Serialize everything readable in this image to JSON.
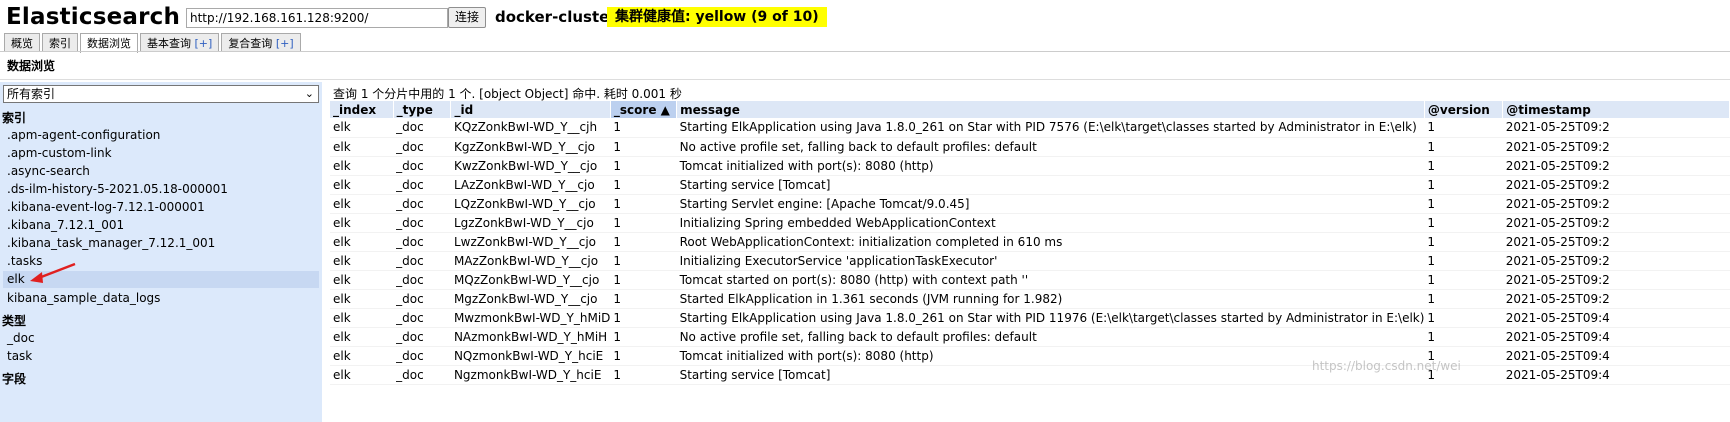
{
  "app": {
    "title": "Elasticsearch"
  },
  "connection": {
    "url": "http://192.168.161.128:9200/",
    "connect_label": "连接",
    "cluster_name": "docker-cluster",
    "health": "集群健康值: yellow (9 of 10)",
    "health_color": "#ffff00"
  },
  "tabs": [
    {
      "label": "概览",
      "plus": ""
    },
    {
      "label": "索引",
      "plus": ""
    },
    {
      "label": "数据浏览",
      "plus": ""
    },
    {
      "label": "基本查询 ",
      "plus": "[+]"
    },
    {
      "label": "复合查询 ",
      "plus": "[+]"
    }
  ],
  "active_tab": "数据浏览",
  "page": {
    "title": "数据浏览"
  },
  "sidebar": {
    "index_select": "所有索引",
    "indices_title": "索引",
    "indices": [
      ".apm-agent-configuration",
      ".apm-custom-link",
      ".async-search",
      ".ds-ilm-history-5-2021.05.18-000001",
      ".kibana-event-log-7.12.1-000001",
      ".kibana_7.12.1_001",
      ".kibana_task_manager_7.12.1_001",
      ".tasks",
      "elk",
      "kibana_sample_data_logs"
    ],
    "selected_index": "elk",
    "types_title": "类型",
    "types": [
      "_doc",
      "task"
    ],
    "fields_title": "字段"
  },
  "results": {
    "summary": "查询 1 个分片中用的 1 个. [object Object] 命中. 耗时 0.001 秒",
    "columns": [
      "_index",
      "_type",
      "_id",
      "_score ▲",
      "message",
      "@version",
      "@timestamp"
    ],
    "rows": [
      [
        "elk",
        "_doc",
        "KQzZonkBwI-WD_Y__cjh",
        "1",
        "Starting ElkApplication using Java 1.8.0_261 on Star with PID 7576 (E:\\elk\\target\\classes started by Administrator in E:\\elk)",
        "1",
        "2021-05-25T09:2"
      ],
      [
        "elk",
        "_doc",
        "KgzZonkBwI-WD_Y__cjo",
        "1",
        "No active profile set, falling back to default profiles: default",
        "1",
        "2021-05-25T09:2"
      ],
      [
        "elk",
        "_doc",
        "KwzZonkBwI-WD_Y__cjo",
        "1",
        "Tomcat initialized with port(s): 8080 (http)",
        "1",
        "2021-05-25T09:2"
      ],
      [
        "elk",
        "_doc",
        "LAzZonkBwI-WD_Y__cjo",
        "1",
        "Starting service [Tomcat]",
        "1",
        "2021-05-25T09:2"
      ],
      [
        "elk",
        "_doc",
        "LQzZonkBwI-WD_Y__cjo",
        "1",
        "Starting Servlet engine: [Apache Tomcat/9.0.45]",
        "1",
        "2021-05-25T09:2"
      ],
      [
        "elk",
        "_doc",
        "LgzZonkBwI-WD_Y__cjo",
        "1",
        "Initializing Spring embedded WebApplicationContext",
        "1",
        "2021-05-25T09:2"
      ],
      [
        "elk",
        "_doc",
        "LwzZonkBwI-WD_Y__cjo",
        "1",
        "Root WebApplicationContext: initialization completed in 610 ms",
        "1",
        "2021-05-25T09:2"
      ],
      [
        "elk",
        "_doc",
        "MAzZonkBwI-WD_Y__cjo",
        "1",
        "Initializing ExecutorService 'applicationTaskExecutor'",
        "1",
        "2021-05-25T09:2"
      ],
      [
        "elk",
        "_doc",
        "MQzZonkBwI-WD_Y__cjo",
        "1",
        "Tomcat started on port(s): 8080 (http) with context path ''",
        "1",
        "2021-05-25T09:2"
      ],
      [
        "elk",
        "_doc",
        "MgzZonkBwI-WD_Y__cjo",
        "1",
        "Started ElkApplication in 1.361 seconds (JVM running for 1.982)",
        "1",
        "2021-05-25T09:2"
      ],
      [
        "elk",
        "_doc",
        "MwzmonkBwI-WD_Y_hMiD",
        "1",
        "Starting ElkApplication using Java 1.8.0_261 on Star with PID 11976 (E:\\elk\\target\\classes started by Administrator in E:\\elk)",
        "1",
        "2021-05-25T09:4"
      ],
      [
        "elk",
        "_doc",
        "NAzmonkBwI-WD_Y_hMiH",
        "1",
        "No active profile set, falling back to default profiles: default",
        "1",
        "2021-05-25T09:4"
      ],
      [
        "elk",
        "_doc",
        "NQzmonkBwI-WD_Y_hciE",
        "1",
        "Tomcat initialized with port(s): 8080 (http)",
        "1",
        "2021-05-25T09:4"
      ],
      [
        "elk",
        "_doc",
        "NgzmonkBwI-WD_Y_hciE",
        "1",
        "Starting service [Tomcat]",
        "1",
        "2021-05-25T09:4"
      ]
    ]
  },
  "watermark": "https://blog.csdn.net/wei"
}
